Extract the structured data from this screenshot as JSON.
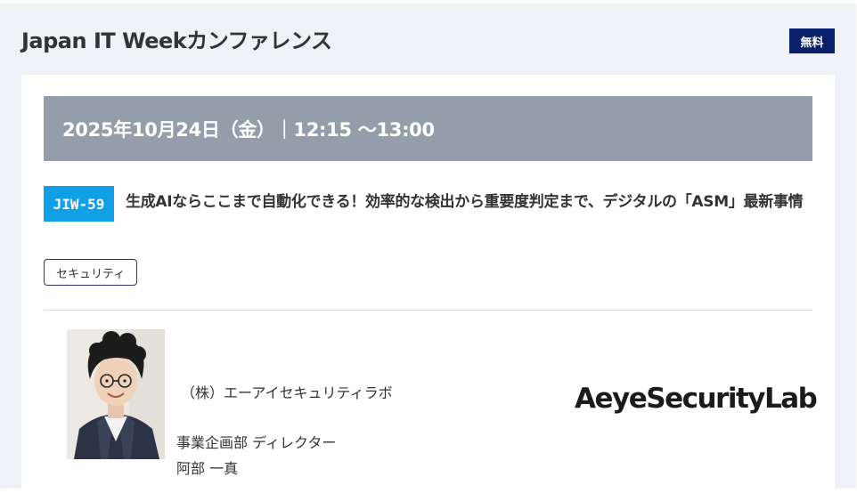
{
  "header": {
    "title": "Japan IT Weekカンファレンス",
    "badge": "無料"
  },
  "session": {
    "datetime": "2025年10月24日（金）｜12:15 〜13:00",
    "code": "JIW-59",
    "title": "生成AIならここまで自動化できる！効率的な検出から重要度判定まで、デジタルの「ASM」最新事情",
    "category": "セキュリティ"
  },
  "speaker": {
    "company": "（株）エーアイセキュリティラボ",
    "role": "事業企画部 ディレクター",
    "name": "阿部 一真",
    "logo_text": "AeyeSecurityLab"
  },
  "colors": {
    "panel_bg": "#eef1f6",
    "badge_bg": "#0a1f6b",
    "date_bar_bg": "#949eab",
    "code_bg": "#11a0e6",
    "tag_border": "#3d2c6b"
  }
}
